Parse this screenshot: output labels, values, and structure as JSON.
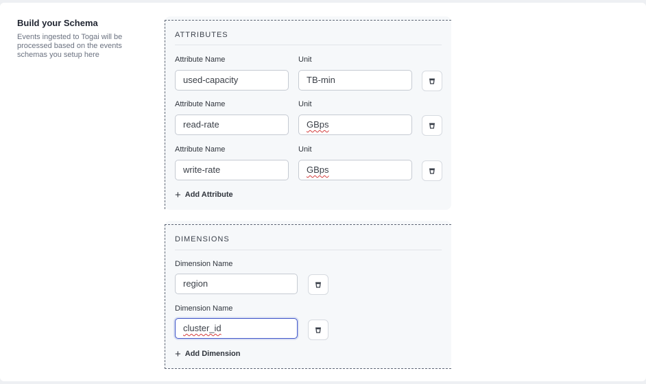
{
  "intro": {
    "title": "Build your Schema",
    "description": "Events ingested to Togai will be processed based on the events schemas you setup here"
  },
  "attributes": {
    "heading": "ATTRIBUTES",
    "name_label": "Attribute Name",
    "unit_label": "Unit",
    "rows": [
      {
        "name": "used-capacity",
        "unit": "TB-min"
      },
      {
        "name": "read-rate",
        "unit": "GBps"
      },
      {
        "name": "write-rate",
        "unit": "GBps"
      }
    ],
    "add_label": "Add Attribute"
  },
  "dimensions": {
    "heading": "DIMENSIONS",
    "name_label": "Dimension Name",
    "rows": [
      {
        "name": "region"
      },
      {
        "name": "cluster_id"
      }
    ],
    "add_label": "Add Dimension"
  },
  "colors": {
    "focus_border": "#3f55c9",
    "section_bg": "#f6f8fa",
    "spellcheck": "#d33a3a"
  },
  "icons": {
    "delete": "trash-icon",
    "add": "plus-icon"
  }
}
